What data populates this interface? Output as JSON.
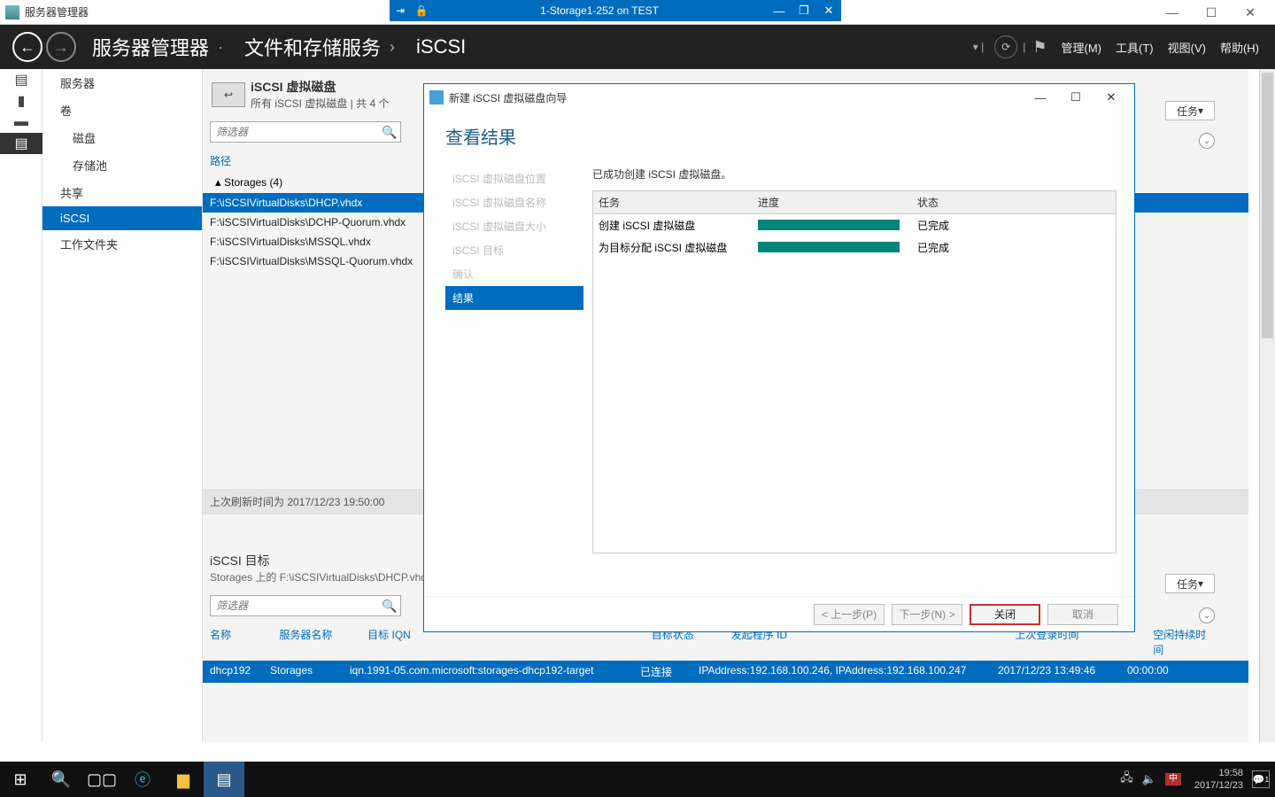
{
  "app_title": "服务器管理器",
  "vm_bar": {
    "name": "1-Storage1-252 on TEST"
  },
  "outer_window": {
    "minimize": "—",
    "maximize": "☐",
    "close": "✕"
  },
  "header": {
    "crumb1": "服务器管理器",
    "crumb2": "文件和存储服务",
    "crumb3": "iSCSI",
    "menu_manage": "管理(M)",
    "menu_tools": "工具(T)",
    "menu_view": "视图(V)",
    "menu_help": "帮助(H)"
  },
  "leftnav": {
    "items": [
      "服务器",
      "卷",
      "磁盘",
      "存储池",
      "共享",
      "iSCSI",
      "工作文件夹"
    ],
    "selected_index": 5
  },
  "panel1": {
    "title": "iSCSI 虚拟磁盘",
    "subtitle": "所有 iSCSI 虚拟磁盘 | 共 4 个",
    "filter_placeholder": "筛选器",
    "col_path": "路径",
    "group": "Storages (4)",
    "rows": [
      "F:\\iSCSIVirtualDisks\\DHCP.vhdx",
      "F:\\iSCSIVirtualDisks\\DCHP-Quorum.vhdx",
      "F:\\iSCSIVirtualDisks\\MSSQL.vhdx",
      "F:\\iSCSIVirtualDisks\\MSSQL-Quorum.vhdx"
    ],
    "selected_row": 0,
    "status": "上次刷新时间为 2017/12/23 19:50:00"
  },
  "panel2": {
    "title": "iSCSI 目标",
    "subtitle": "Storages 上的 F:\\iSCSIVirtualDisks\\DHCP.vhdx",
    "filter_placeholder": "筛选器",
    "headers": [
      "名称",
      "服务器名称",
      "目标 IQN",
      "目标状态",
      "发起程序 ID",
      "上次登录时间",
      "空闲持续时间"
    ],
    "row": {
      "name": "dhcp192",
      "server": "Storages",
      "iqn": "iqn.1991-05.com.microsoft:storages-dhcp192-target",
      "status": "已连接",
      "initiator": "IPAddress:192.168.100.246, IPAddress:192.168.100.247",
      "last_login": "2017/12/23 13:49:46",
      "idle": "00:00:00"
    }
  },
  "tasks_label": "任务",
  "dialog": {
    "title": "新建 iSCSI 虚拟磁盘向导",
    "heading": "查看结果",
    "steps": [
      "iSCSI 虚拟磁盘位置",
      "iSCSI 虚拟磁盘名称",
      "iSCSI 虚拟磁盘大小",
      "iSCSI 目标",
      "确认",
      "结果"
    ],
    "active_step": 5,
    "message": "已成功创建 iSCSI 虚拟磁盘。",
    "table": {
      "headers": [
        "任务",
        "进度",
        "状态"
      ],
      "rows": [
        {
          "task": "创建 iSCSI 虚拟磁盘",
          "status": "已完成"
        },
        {
          "task": "为目标分配 iSCSI 虚拟磁盘",
          "status": "已完成"
        }
      ]
    },
    "btn_prev": "< 上一步(P)",
    "btn_next": "下一步(N) >",
    "btn_close": "关闭",
    "btn_cancel": "取消"
  },
  "taskbar": {
    "ime": "中",
    "time": "19:58",
    "date": "2017/12/23",
    "notif_count": "1"
  }
}
